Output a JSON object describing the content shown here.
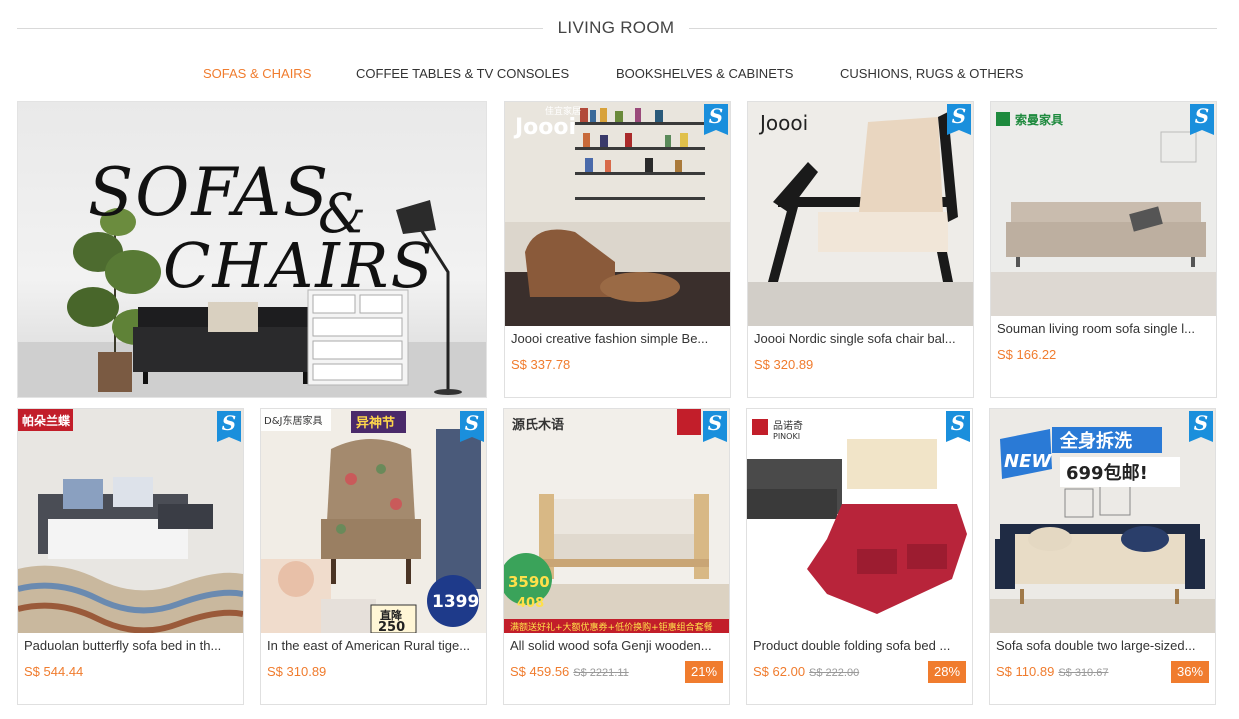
{
  "section": {
    "title": "LIVING ROOM"
  },
  "tabs": [
    {
      "label": "SOFAS & CHAIRS"
    },
    {
      "label": "COFFEE TABLES & TV CONSOLES"
    },
    {
      "label": "BOOKSHELVES & CABINETS"
    },
    {
      "label": "CUSHIONS, RUGS & OTHERS"
    }
  ],
  "banner": {
    "line1": "SOFAS",
    "amp": "&",
    "line2": "CHAIRS"
  },
  "badge": "S",
  "products": [
    {
      "name": "Joooi creative fashion simple Be...",
      "price": "S$ 337.78",
      "old": "",
      "discount": "",
      "brand": "Joooi",
      "brand_cn": "佳宜家居",
      "accent": "#8a5a3a"
    },
    {
      "name": "Joooi Nordic single sofa chair bal...",
      "price": "S$ 320.89",
      "old": "",
      "discount": "",
      "brand": "Joooi",
      "accent": "#e7d6c2"
    },
    {
      "name": "Souman living room sofa single l...",
      "price": "S$ 166.22",
      "old": "",
      "discount": "",
      "brand": "索曼家具",
      "accent": "#c9bcae"
    },
    {
      "name": "Paduolan butterfly sofa bed in th...",
      "price": "S$ 544.44",
      "old": "",
      "discount": "",
      "brand": "帕朵兰蝶",
      "accent": "#4a4d55"
    },
    {
      "name": "In the east of American Rural tige...",
      "price": "S$ 310.89",
      "old": "",
      "discount": "",
      "brand": "D&J东居家具",
      "promo": "异神节",
      "promo_price": "1399",
      "drop": "直降",
      "drop_val": "250",
      "accent": "#a48a6e"
    },
    {
      "name": "All solid wood sofa Genji wooden...",
      "price": "S$ 459.56",
      "old": "S$ 2221.11",
      "discount": "21%",
      "brand": "源氏木语",
      "promo_price": "3590",
      "sub_val": "408",
      "banner_text": "满额送好礼+大额优惠券+低价换购+钜惠组合套餐",
      "accent": "#d8c2a0"
    },
    {
      "name": "Product double folding sofa bed ...",
      "price": "S$ 62.00",
      "old": "S$ 222.00",
      "discount": "28%",
      "brand": "品诺奇",
      "brand_en": "PINOKI",
      "accent": "#b8243a"
    },
    {
      "name": "Sofa sofa double two large-sized...",
      "price": "S$ 110.89",
      "old": "S$ 310.67",
      "discount": "36%",
      "brand": "NEW",
      "promo": "全身拆洗",
      "promo2": "699包邮!",
      "accent": "#1f2b44"
    }
  ]
}
